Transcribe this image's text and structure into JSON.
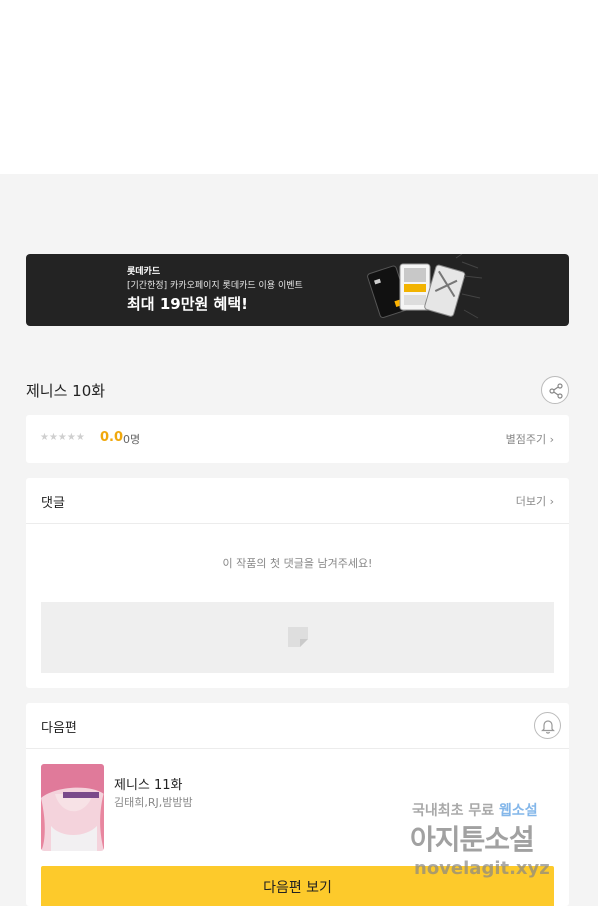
{
  "banner": {
    "brand": "롯데카드",
    "subtitle": "[기간한정] 카카오페이지 롯데카드 이용 이벤트",
    "headline": "최대 19만원 혜택!"
  },
  "episode": {
    "title": "제니스 10화"
  },
  "rating": {
    "stars": "★★★★★",
    "score": "0.0",
    "count": "0명",
    "rate_link": "별점주기 ›"
  },
  "comments": {
    "label": "댓글",
    "more": "더보기 ›",
    "empty_message": "이 작품의 첫 댓글을 남겨주세요!"
  },
  "next": {
    "label": "다음편",
    "episode_title": "제니스 11화",
    "authors": "김태희,RJ,밤밤밤",
    "button_label": "다음편 보기"
  },
  "watermark": {
    "line1_a": "국내최초 무료",
    "line1_b": "웹소설",
    "line2": "아지툰소설",
    "line3": "novelagit.xyz"
  },
  "icons": {
    "share": "share-icon",
    "bell": "bell-icon",
    "chevron": "chevron-right-icon"
  },
  "colors": {
    "accent": "#fdca2b",
    "score": "#f0a80c",
    "banner_bg": "#232323"
  }
}
